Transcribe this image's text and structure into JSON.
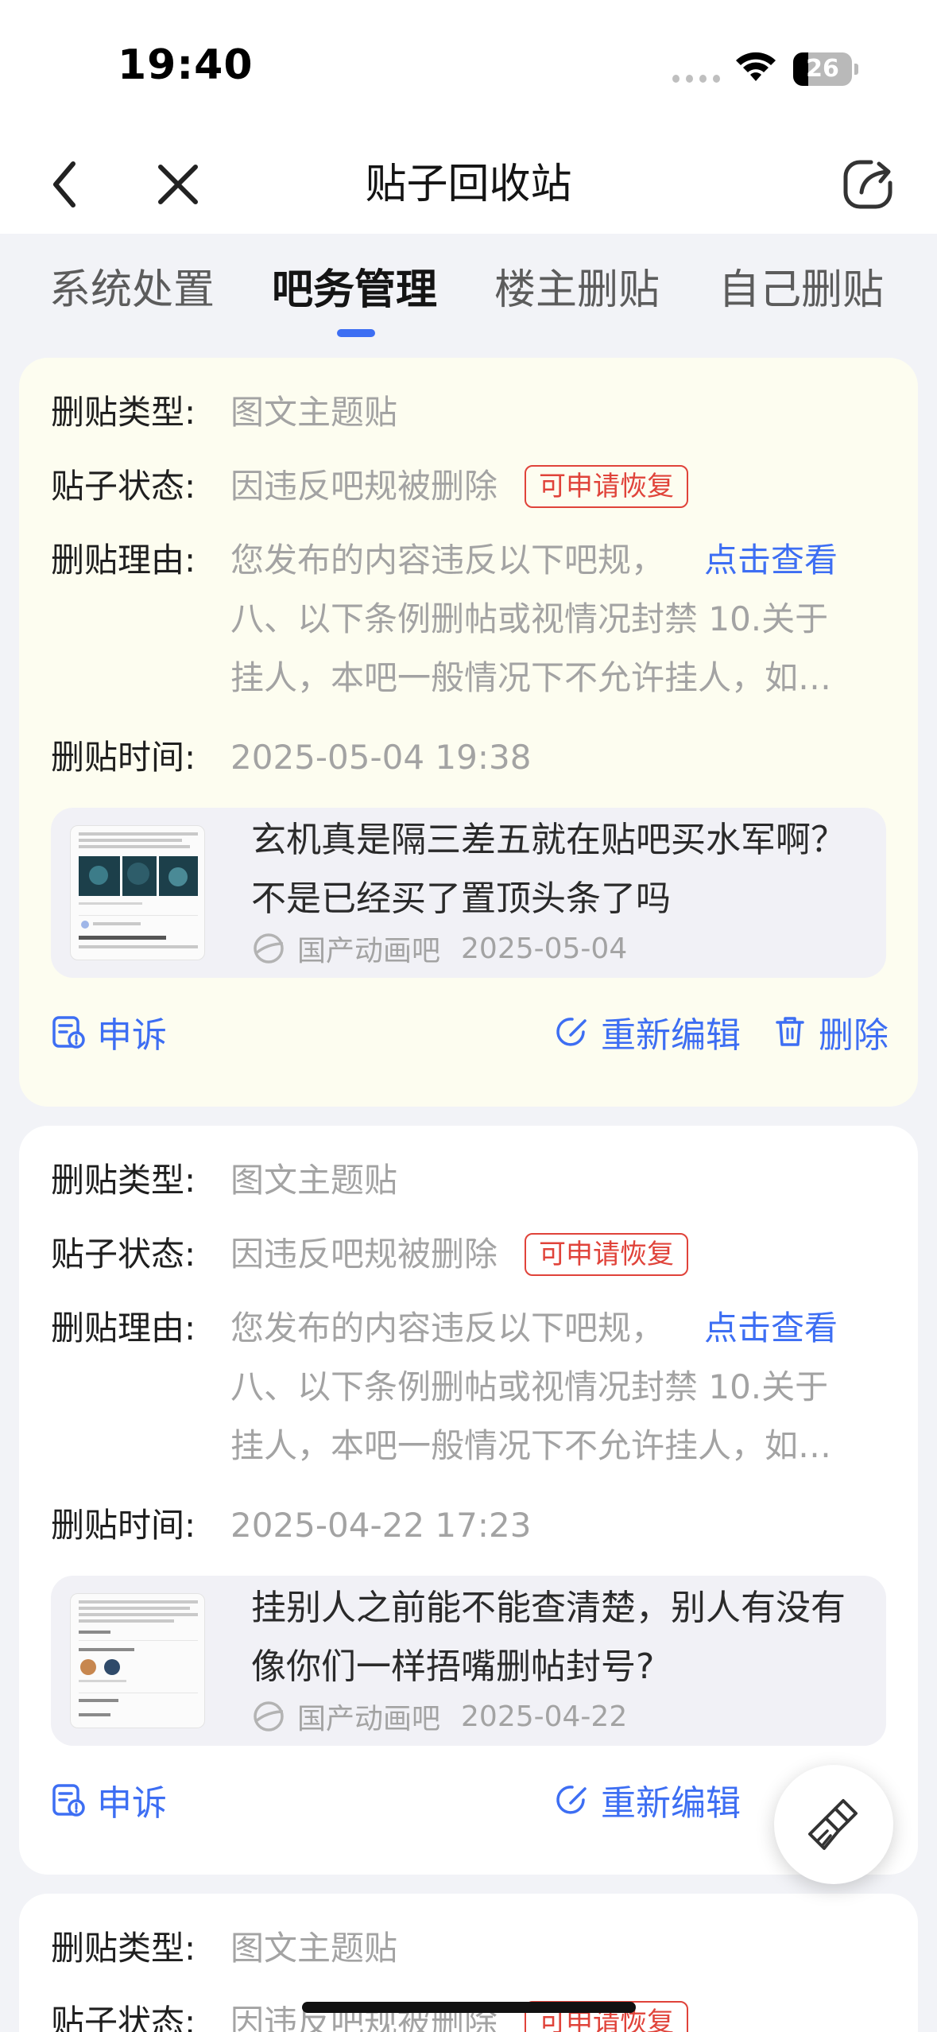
{
  "status_bar": {
    "time": "19:40",
    "battery": "26",
    "battery_level": 0.26
  },
  "nav": {
    "title": "贴子回收站",
    "back_icon": "chevron-left-icon",
    "close_icon": "close-icon",
    "share_icon": "share-icon"
  },
  "tabs": [
    {
      "label": "系统处置",
      "active": false
    },
    {
      "label": "吧务管理",
      "active": true
    },
    {
      "label": "楼主删贴",
      "active": false
    },
    {
      "label": "自己删贴",
      "active": false
    }
  ],
  "labels": {
    "type": "删贴类型:",
    "status": "贴子状态:",
    "reason": "删贴理由:",
    "time": "删贴时间:"
  },
  "actions": {
    "appeal": "申诉",
    "reedit": "重新编辑",
    "delete": "删除"
  },
  "posts": [
    {
      "type": "图文主题贴",
      "status": "因违反吧规被删除",
      "badge": "可申请恢复",
      "reason_prefix": "您发布的内容违反以下吧规，",
      "view_link": "点击查看",
      "reason_line2": "八、以下条例删帖或视情况封禁 10.关于",
      "reason_line3": "挂人，本吧一般情况下不允许挂人，如…",
      "time": "2025-05-04 19:38",
      "title": "玄机真是隔三差五就在贴吧买水军啊？不是已经买了置顶头条了吗",
      "forum": "国产动画吧",
      "date": "2025-05-04"
    },
    {
      "type": "图文主题贴",
      "status": "因违反吧规被删除",
      "badge": "可申请恢复",
      "reason_prefix": "您发布的内容违反以下吧规，",
      "view_link": "点击查看",
      "reason_line2": "八、以下条例删帖或视情况封禁 10.关于",
      "reason_line3": "挂人，本吧一般情况下不允许挂人，如…",
      "time": "2025-04-22 17:23",
      "title": "挂别人之前能不能查清楚，别人有没有像你们一样捂嘴删帖封号?",
      "forum": "国产动画吧",
      "date": "2025-04-22"
    },
    {
      "type": "图文主题贴",
      "status": "因违反吧规被删除",
      "badge": "可申请恢复"
    }
  ],
  "colors": {
    "accent": "#3d6ef3",
    "badge": "#e0433a",
    "muted": "#a3a3a3",
    "highlight_card": "#fdfdf0"
  },
  "fab_icon": "broom-icon"
}
